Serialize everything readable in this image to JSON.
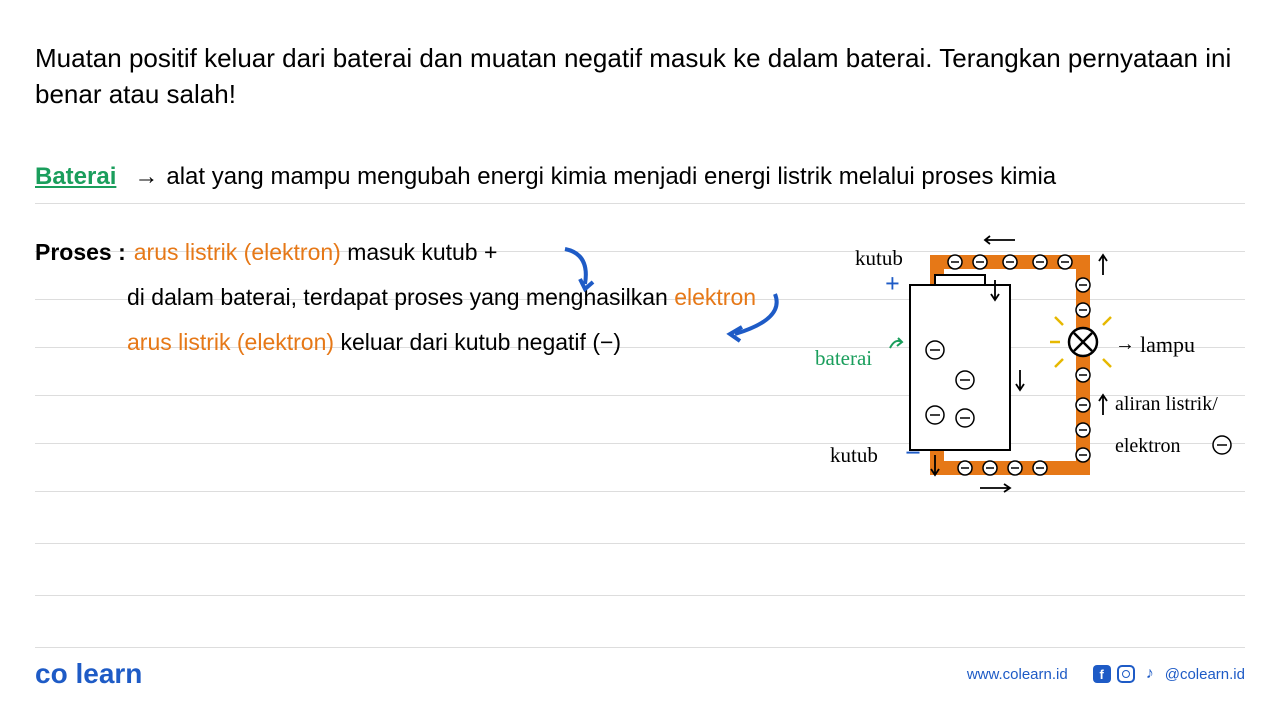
{
  "question": "Muatan positif keluar dari baterai dan muatan negatif masuk ke dalam baterai. Terangkan pernyataan ini benar atau salah!",
  "definition": {
    "term": "Baterai",
    "text": "alat yang mampu mengubah energi kimia menjadi energi listrik melalui proses kimia"
  },
  "proses": {
    "label": "Proses :",
    "line1_orange": "arus listrik (elektron)",
    "line1_black": "masuk kutub +",
    "line2_black": "di dalam baterai, terdapat proses yang menghasilkan",
    "line2_orange": "elektron",
    "line3_orange": "arus listrik (elektron)",
    "line3_black": "keluar dari kutub negatif (−)"
  },
  "diagram": {
    "kutub_plus": "kutub",
    "plus_sign": "+",
    "baterai_label": "baterai",
    "kutub_minus": "kutub",
    "minus_sign": "−",
    "lampu": "lampu",
    "aliran": "aliran listrik/",
    "elektron": "elektron"
  },
  "footer": {
    "logo_co": "co",
    "logo_learn": "learn",
    "website": "www.colearn.id",
    "handle": "@colearn.id"
  }
}
